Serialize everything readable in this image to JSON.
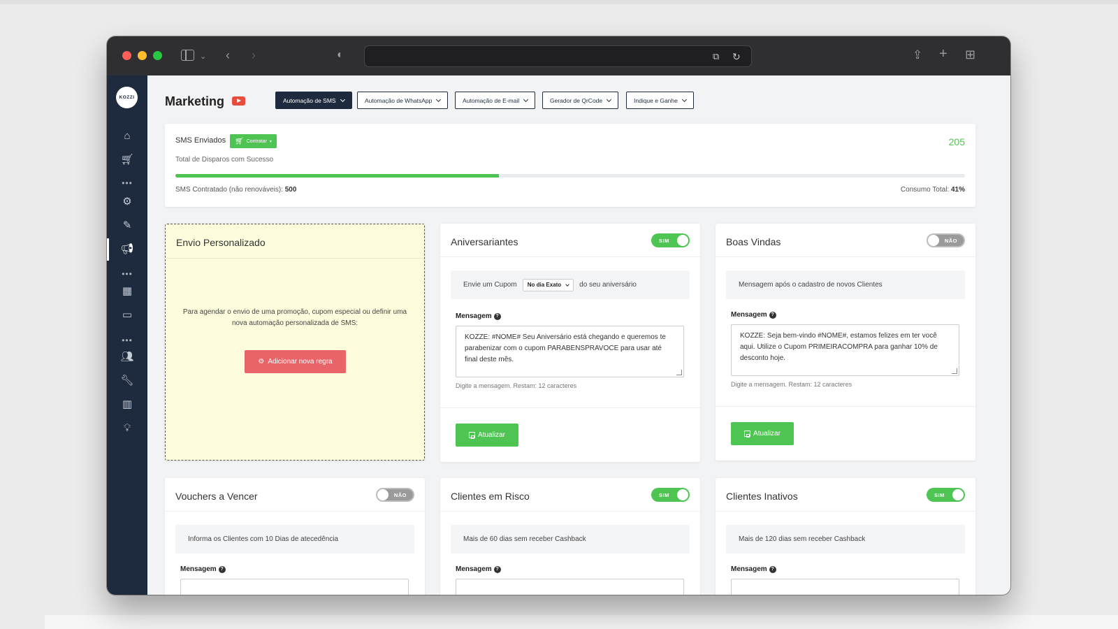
{
  "page": {
    "title": "Marketing",
    "tabs": [
      {
        "label": "Automação de SMS",
        "active": true
      },
      {
        "label": "Automação de WhatsApp",
        "active": false
      },
      {
        "label": "Automação de E-mail",
        "active": false
      },
      {
        "label": "Gerador de QrCode",
        "active": false
      },
      {
        "label": "Indique e Ganhe",
        "active": false
      }
    ]
  },
  "sidebar": {
    "logo_text": "KOZZI",
    "icons": [
      "home-icon",
      "cart-icon",
      "more-dots-icon",
      "gear-icon",
      "brush-icon",
      "megaphone-icon",
      "more-dots-icon",
      "qrcode-icon",
      "monitor-icon",
      "more-dots-icon",
      "users-icon",
      "wrench-icon",
      "bar-chart-icon",
      "lightbulb-icon"
    ],
    "active_item": "megaphone-icon"
  },
  "stats": {
    "label": "SMS Enviados",
    "contratar_label": "Contratar",
    "subtitle": "Total de Disparos com Sucesso",
    "count": "205",
    "progress_fraction": 0.41,
    "contracted_label": "SMS Contratado (não renováveis):",
    "contracted_value": "500",
    "consumption_label": "Consumo Total:",
    "consumption_value": "41%",
    "accent_color": "#4ec452"
  },
  "custom": {
    "title": "Envio Personalizado",
    "text": "Para agendar o envio de uma promoção, cupom especial ou definir uma nova automação personalizada de SMS:",
    "button_label": "Adicionar nova regra"
  },
  "rules": {
    "aniversariantes": {
      "title": "Aniversariantes",
      "toggle_label": "SIM",
      "enabled": true,
      "info_prefix": "Envie um Cupom",
      "select_value": "No dia Exato",
      "info_suffix": "do seu aniversário",
      "message_label": "Mensagem",
      "message": "KOZZE: #NOME# Seu Aniversário está chegando e queremos te parabenizar com o cupom PARABENSPRAVOCE para usar até final deste mês.",
      "hint": "Digite a mensagem. Restam: 12 caracteres",
      "button_label": "Atualizar"
    },
    "boas_vindas": {
      "title": "Boas Vindas",
      "toggle_label": "NÃO",
      "enabled": false,
      "info": "Mensagem após o cadastro de novos Clientes",
      "message_label": "Mensagem",
      "message": "KOZZE: Seja bem-vindo #NOME#, estamos felizes em ter você aqui. Utilize o Cupom PRIMEIRACOMPRA para ganhar 10% de desconto hoje.",
      "hint": "Digite a mensagem. Restam: 12 caracteres",
      "button_label": "Atualizar"
    },
    "vouchers": {
      "title": "Vouchers a Vencer",
      "toggle_label": "NÃO",
      "enabled": false,
      "info": "Informa os Clientes com 10 Dias de atecedência",
      "message_label": "Mensagem"
    },
    "risco": {
      "title": "Clientes em Risco",
      "toggle_label": "SIM",
      "enabled": true,
      "info": "Mais de 60 dias sem receber Cashback",
      "message_label": "Mensagem"
    },
    "inativos": {
      "title": "Clientes Inativos",
      "toggle_label": "SIM",
      "enabled": true,
      "info": "Mais de 120 dias sem receber Cashback",
      "message_label": "Mensagem"
    }
  }
}
